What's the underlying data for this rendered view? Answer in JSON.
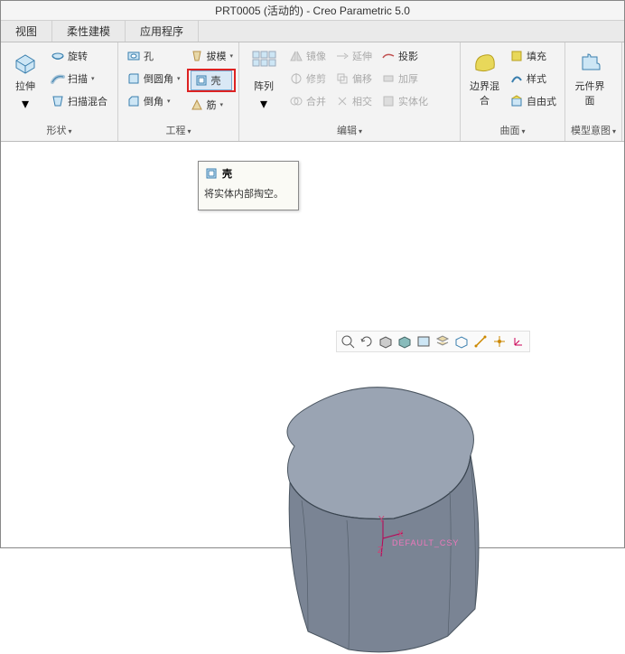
{
  "title": "PRT0005 (活动的) - Creo Parametric 5.0",
  "tabs": {
    "view": "视图",
    "flex": "柔性建模",
    "app": "应用程序"
  },
  "groups": {
    "shape": {
      "label": "形状",
      "extrude": "拉伸",
      "revolve": "旋转",
      "sweep": "扫描",
      "sweep_blend": "扫描混合"
    },
    "engineering": {
      "label": "工程",
      "hole": "孔",
      "draft": "拔模",
      "round": "倒圆角",
      "shell": "壳",
      "chamfer": "倒角",
      "rib": "筋"
    },
    "edit": {
      "label": "编辑",
      "pattern": "阵列",
      "mirror": "镜像",
      "trim": "修剪",
      "merge": "合并",
      "extend": "延伸",
      "offset": "偏移",
      "intersect": "相交",
      "project": "投影",
      "thicken": "加厚",
      "solidify": "实体化"
    },
    "surface": {
      "label": "曲面",
      "boundary": "边界混合",
      "fill": "填充",
      "style": "样式",
      "freestyle": "自由式"
    },
    "model_intent": {
      "label": "模型意图",
      "udf": "元件界面"
    }
  },
  "tooltip": {
    "title": "壳",
    "body": "将实体内部掏空。"
  },
  "csys": {
    "x": "X",
    "y": "Y",
    "z": "Z",
    "default": "DEFAULT_CSY"
  }
}
